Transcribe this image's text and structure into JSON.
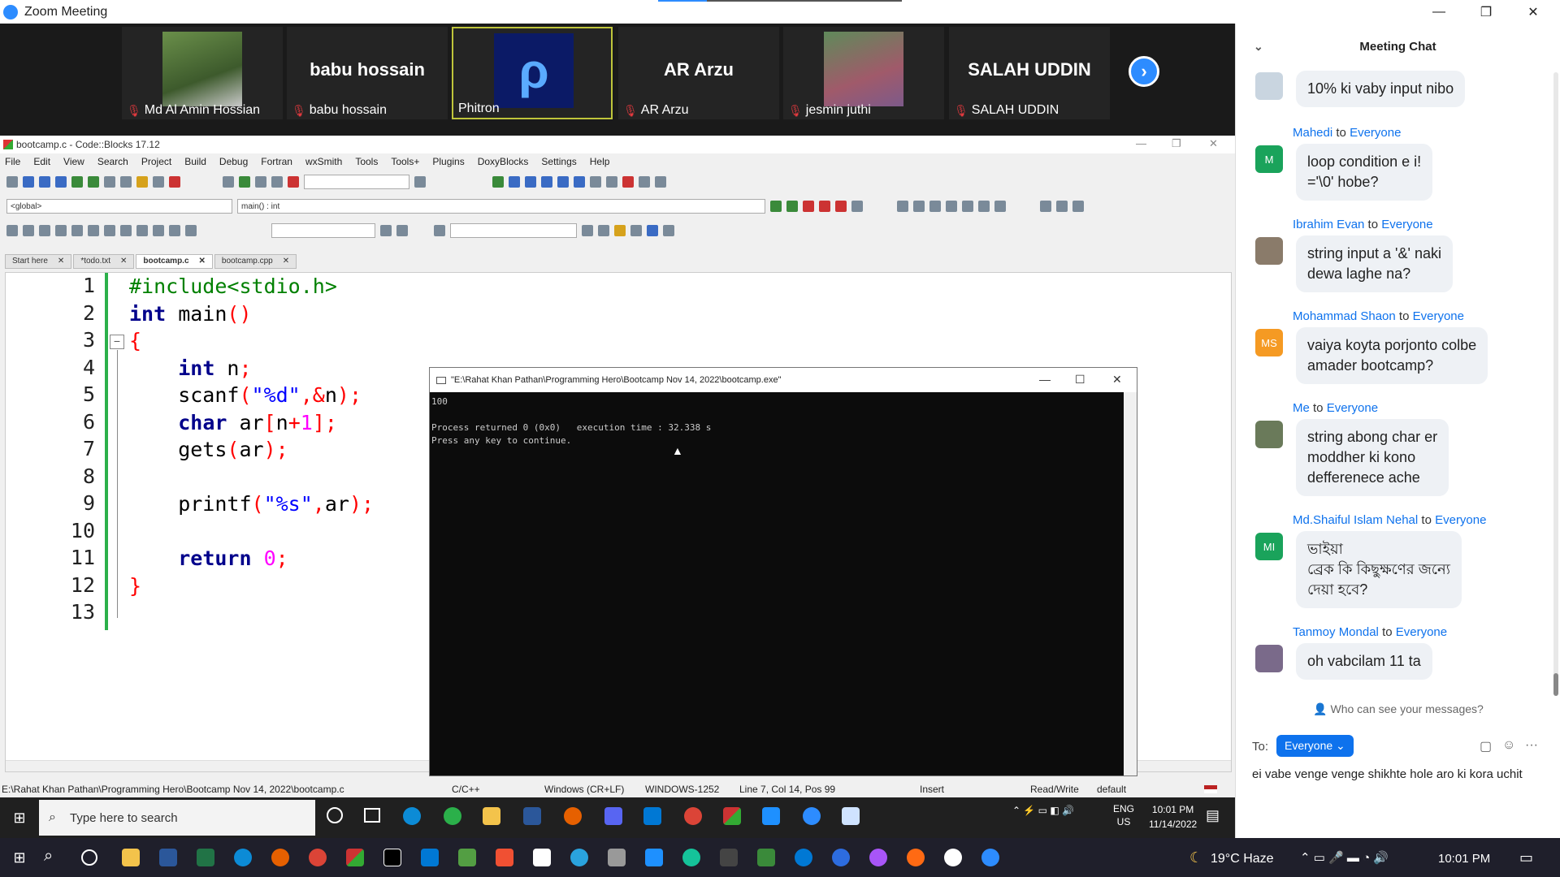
{
  "zoom": {
    "title": "Zoom Meeting",
    "participants": [
      {
        "name": "Md Al Amin Hossian",
        "display": "photo"
      },
      {
        "name": "babu hossain",
        "display": "babu hossain"
      },
      {
        "name": "Phitron",
        "display": "logo"
      },
      {
        "name": "AR Arzu",
        "display": "AR Arzu"
      },
      {
        "name": "jesmin juthi",
        "display": "photo"
      },
      {
        "name": "SALAH UDDIN",
        "display": "SALAH UDDIN"
      }
    ]
  },
  "codeblocks": {
    "title": "bootcamp.c - Code::Blocks 17.12",
    "menu": [
      "File",
      "Edit",
      "View",
      "Search",
      "Project",
      "Build",
      "Debug",
      "Fortran",
      "wxSmith",
      "Tools",
      "Tools+",
      "Plugins",
      "DoxyBlocks",
      "Settings",
      "Help"
    ],
    "scope_combo": "<global>",
    "function_combo": "main() : int",
    "tabs": [
      "Start here",
      "*todo.txt",
      "bootcamp.c",
      "bootcamp.cpp"
    ],
    "line_numbers": [
      "1",
      "2",
      "3",
      "4",
      "5",
      "6",
      "7",
      "8",
      "9",
      "10",
      "11",
      "12",
      "13"
    ],
    "status": {
      "path": "E:\\Rahat Khan Pathan\\Programming Hero\\Bootcamp Nov 14, 2022\\bootcamp.c",
      "lang": "C/C++",
      "eol": "Windows (CR+LF)",
      "encoding": "WINDOWS-1252",
      "position": "Line 7, Col 14, Pos 99",
      "mode": "Insert",
      "access": "Read/Write",
      "profile": "default"
    }
  },
  "console": {
    "title": "\"E:\\Rahat Khan Pathan\\Programming Hero\\Bootcamp Nov 14, 2022\\bootcamp.exe\"",
    "output": "100\n\nProcess returned 0 (0x0)   execution time : 32.338 s\nPress any key to continue."
  },
  "chat": {
    "header": "Meeting Chat",
    "messages": [
      {
        "sender": "",
        "to": "",
        "avatar": "",
        "text": "10% ki vaby input nibo"
      },
      {
        "sender": "Mahedi",
        "to": "Everyone",
        "avatar": "M",
        "color": "#1aa35b",
        "text": "loop condition e i!\n='\\0' hobe?"
      },
      {
        "sender": "Ibrahim Evan",
        "to": "Everyone",
        "avatar": "",
        "text": "string input a '&' naki\ndewa laghe na?"
      },
      {
        "sender": "Mohammad Shaon",
        "to": "Everyone",
        "avatar": "MS",
        "color": "#f59a23",
        "text": "vaiya koyta porjonto colbe\namader bootcamp?"
      },
      {
        "sender": "Me",
        "to": "Everyone",
        "avatar": "",
        "text": "string abong char er\nmoddher ki kono\ndefferenece ache"
      },
      {
        "sender": "Md.Shaiful Islam Nehal",
        "to": "Everyone",
        "avatar": "MI",
        "color": "#1aa35b",
        "text": "ভাইয়া\nব্রেক কি কিছুক্ষণের জন্যে\nদেয়া হবে?"
      },
      {
        "sender": "Tanmoy Mondal",
        "to": "Everyone",
        "avatar": "",
        "text": "oh vabcilam 11 ta"
      }
    ],
    "to_word": "to",
    "who_can_see": "Who can see your messages?",
    "to_label": "To:",
    "recipient": "Everyone",
    "draft": "ei vabe venge venge shikhte hole aro ki kora uchit"
  },
  "taskbar": {
    "search_placeholder": "Type here to search",
    "lang": "ENG",
    "region": "US",
    "time": "10:01 PM",
    "date": "11/14/2022",
    "weather": "19°C  Haze",
    "time2": "10:01 PM"
  }
}
